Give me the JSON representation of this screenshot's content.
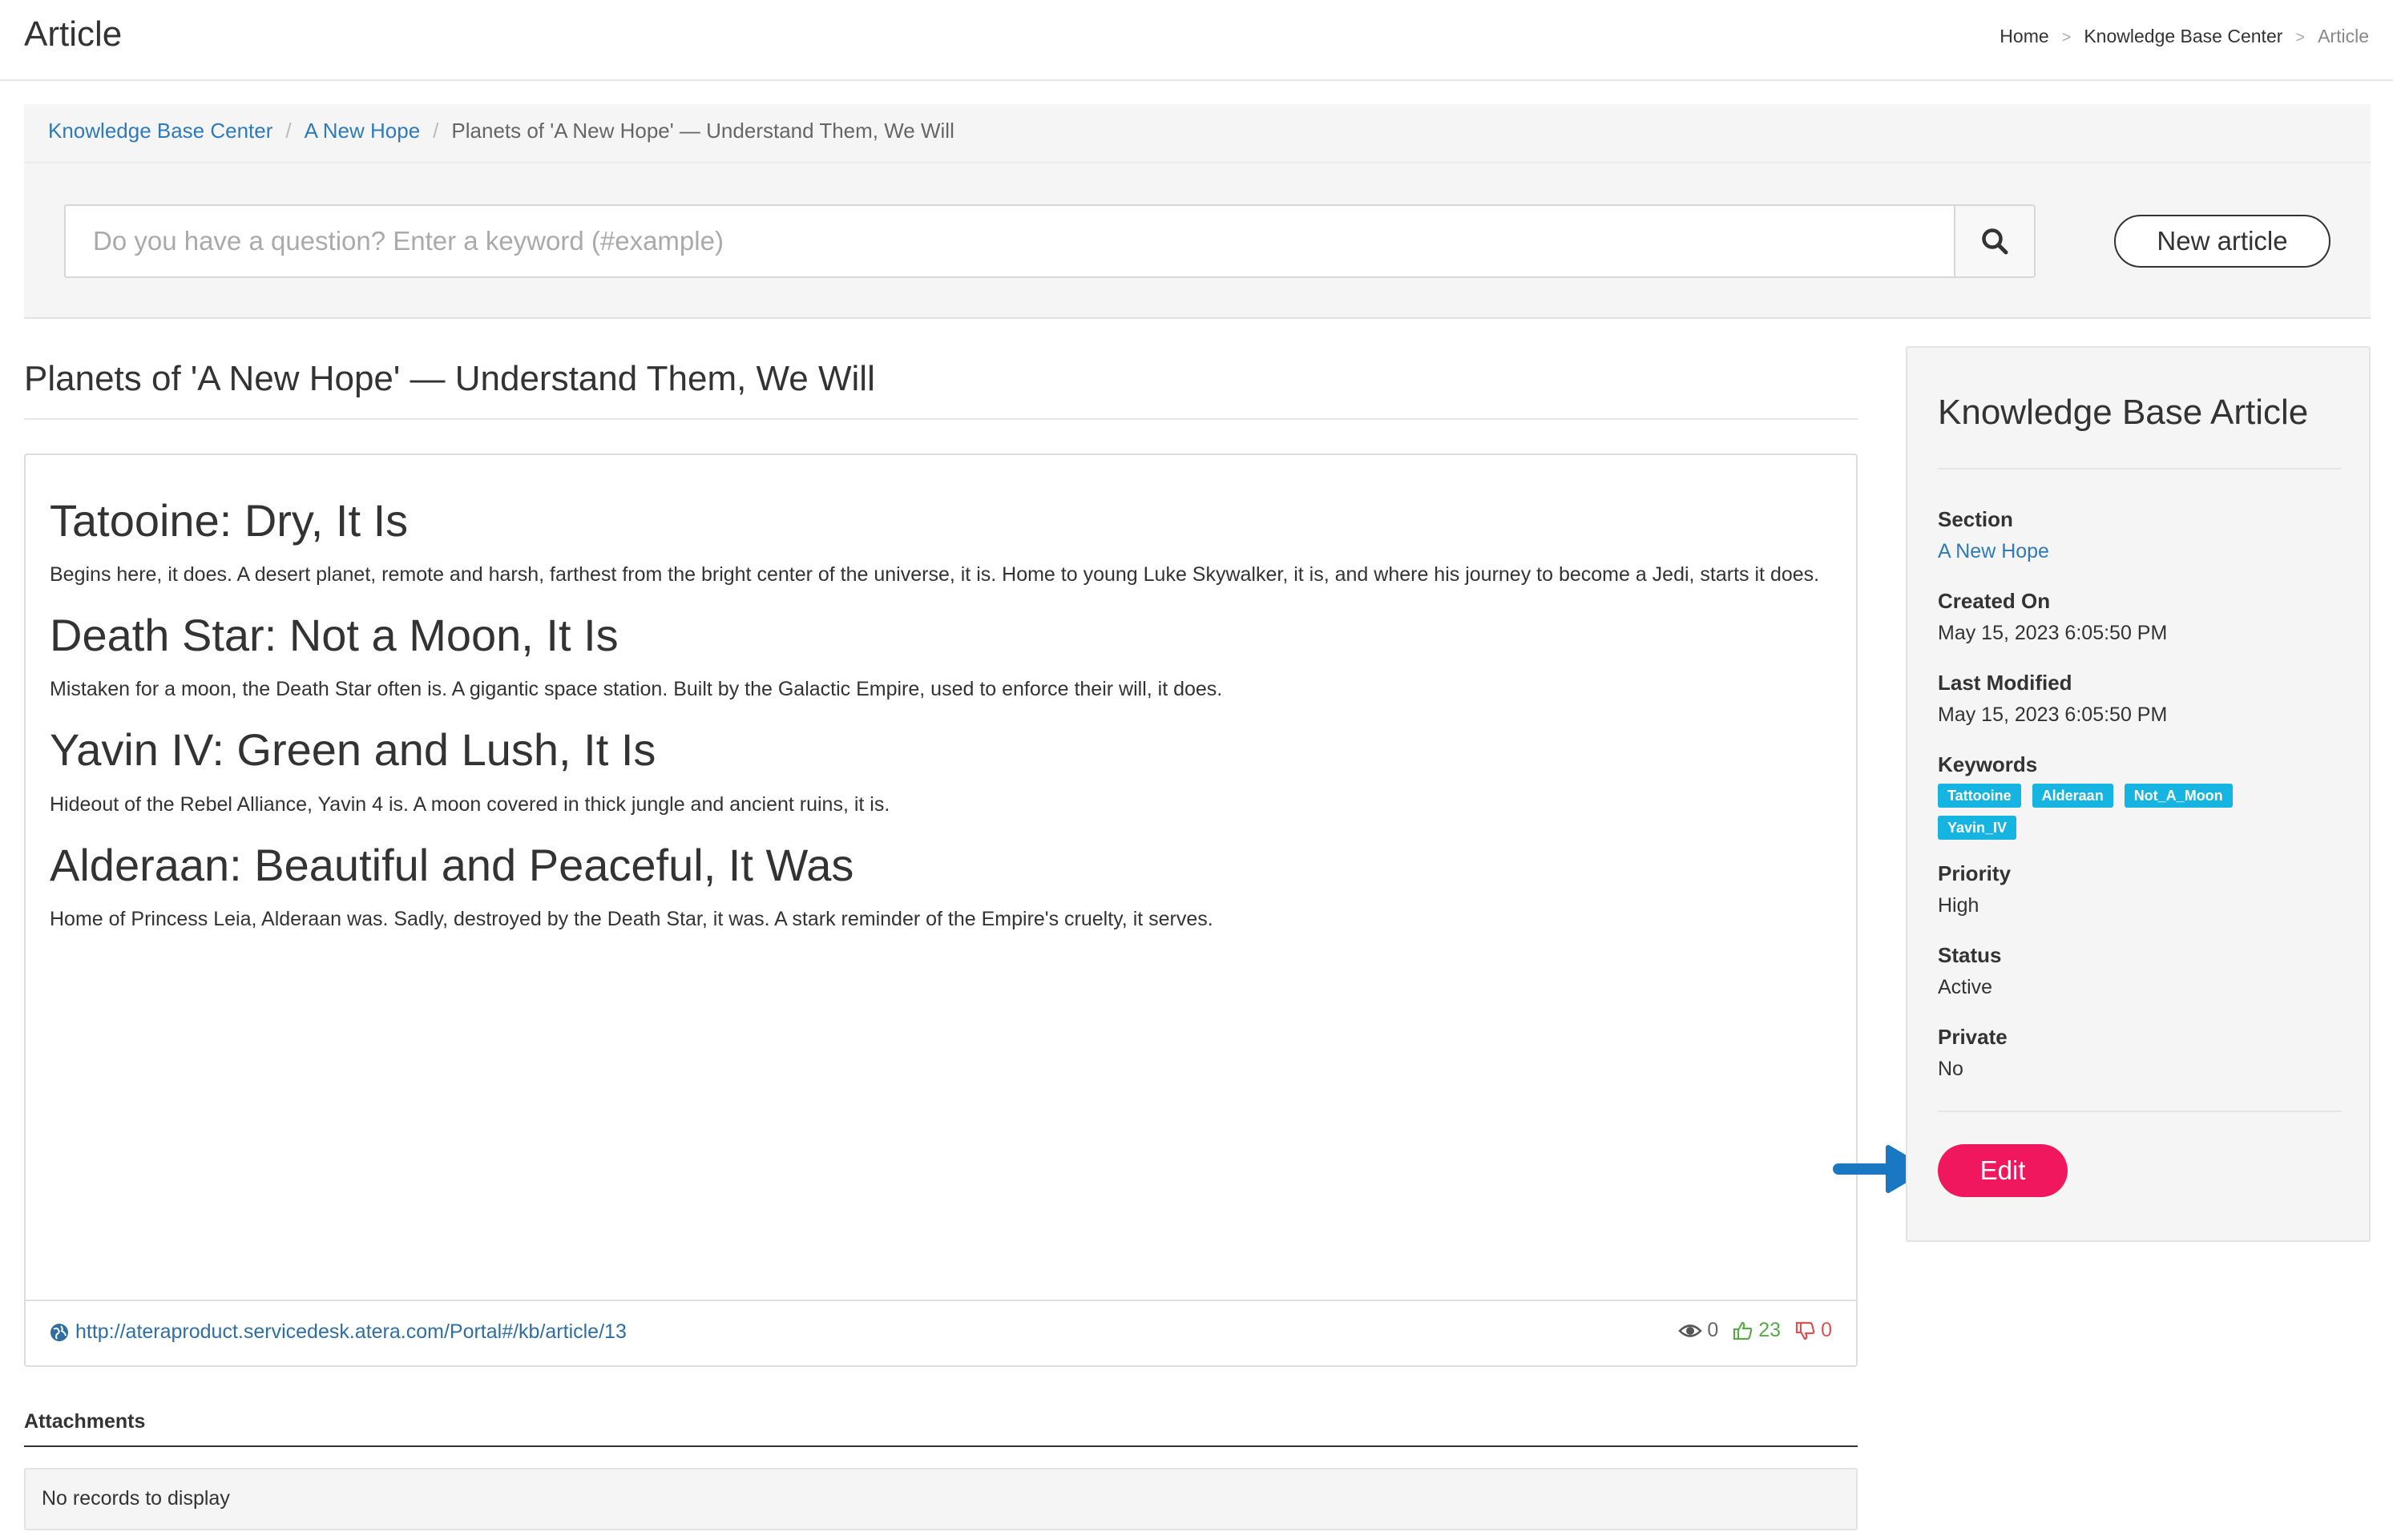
{
  "header": {
    "title": "Article",
    "breadcrumb": [
      "Home",
      "Knowledge Base Center",
      "Article"
    ]
  },
  "panel": {
    "breadcrumb": {
      "items": [
        "Knowledge Base Center",
        "A New Hope"
      ],
      "current": "Planets of 'A New Hope' — Understand Them, We Will"
    },
    "search": {
      "placeholder": "Do you have a question? Enter a keyword (#example)",
      "value": ""
    },
    "new_article_label": "New article"
  },
  "article": {
    "title": "Planets of 'A New Hope' — Understand Them, We Will",
    "sections": [
      {
        "heading": "Tatooine: Dry, It Is",
        "body": "Begins here, it does. A desert planet, remote and harsh, farthest from the bright center of the universe, it is. Home to young Luke Skywalker, it is, and where his journey to become a Jedi, starts it does."
      },
      {
        "heading": "Death Star: Not a Moon, It Is",
        "body": "Mistaken for a moon, the Death Star often is. A gigantic space station. Built by the Galactic Empire, used to enforce their will, it does."
      },
      {
        "heading": "Yavin IV: Green and Lush, It Is",
        "body": "Hideout of the Rebel Alliance, Yavin 4 is. A moon covered in thick jungle and ancient ruins, it is."
      },
      {
        "heading": "Alderaan: Beautiful and Peaceful, It Was",
        "body": "Home of Princess Leia, Alderaan was. Sadly, destroyed by the Death Star, it was. A stark reminder of the Empire's cruelty, it serves."
      }
    ],
    "url": "http://ateraproduct.servicedesk.atera.com/Portal#/kb/article/13",
    "stats": {
      "views": "0",
      "likes": "23",
      "dislikes": "0"
    }
  },
  "attachments": {
    "title": "Attachments",
    "empty_text": "No records to display"
  },
  "sidebar": {
    "title": "Knowledge Base Article",
    "section_label": "Section",
    "section_value": "A New Hope",
    "created_label": "Created On",
    "created_value": "May 15, 2023 6:05:50 PM",
    "modified_label": "Last Modified",
    "modified_value": "May 15, 2023 6:05:50 PM",
    "keywords_label": "Keywords",
    "keywords": [
      "Tattooine",
      "Alderaan",
      "Not_A_Moon",
      "Yavin_IV"
    ],
    "priority_label": "Priority",
    "priority_value": "High",
    "status_label": "Status",
    "status_value": "Active",
    "private_label": "Private",
    "private_value": "No",
    "edit_label": "Edit"
  },
  "colors": {
    "link": "#2f7ab8",
    "tag": "#16b4e0",
    "edit_button": "#f0175f",
    "arrow": "#1a78c2",
    "like": "#5aa84a",
    "dislike": "#d9534f"
  },
  "icons": [
    "search-icon",
    "globe-icon",
    "eye-icon",
    "thumbs-up-icon",
    "thumbs-down-icon",
    "arrow-right-icon"
  ]
}
